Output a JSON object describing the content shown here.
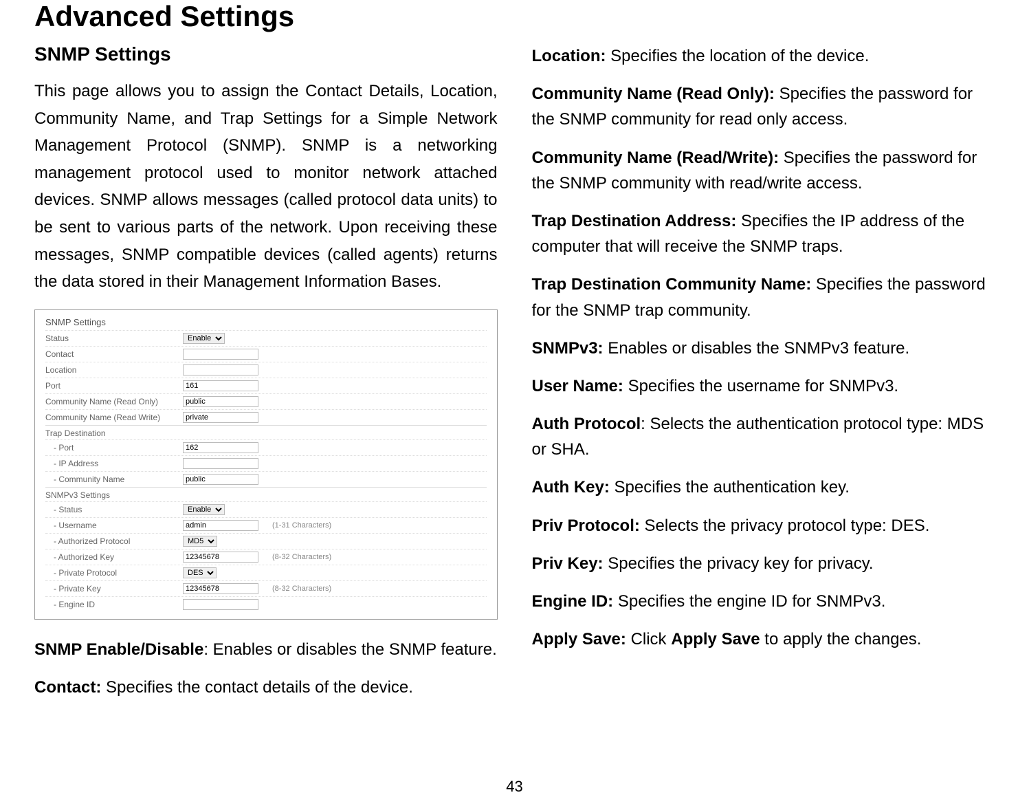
{
  "title": "Advanced Settings",
  "left": {
    "subtitle": "SNMP Settings",
    "intro": "This page allows you to assign the Contact Details, Location, Community Name, and Trap Settings for a Simple Network Management Protocol (SNMP). SNMP is a networking management protocol used to monitor network attached devices. SNMP allows messages (called protocol data units) to be sent to various parts of the network. Upon receiving these messages, SNMP compatible devices (called agents) returns the data stored in their Management Information Bases."
  },
  "screenshot": {
    "header": "SNMP Settings",
    "rows": {
      "status_label": "Status",
      "status_value": "Enable",
      "contact_label": "Contact",
      "contact_value": "",
      "location_label": "Location",
      "location_value": "",
      "port_label": "Port",
      "port_value": "161",
      "comm_ro_label": "Community Name (Read Only)",
      "comm_ro_value": "public",
      "comm_rw_label": "Community Name (Read Write)",
      "comm_rw_value": "private",
      "trap_header": "Trap Destination",
      "trap_port_label": "- Port",
      "trap_port_value": "162",
      "trap_ip_label": "- IP Address",
      "trap_ip_value": "",
      "trap_comm_label": "- Community Name",
      "trap_comm_value": "public",
      "v3_header": "SNMPv3 Settings",
      "v3_status_label": "- Status",
      "v3_status_value": "Enable",
      "v3_user_label": "- Username",
      "v3_user_value": "admin",
      "v3_user_hint": "(1-31 Characters)",
      "v3_authproto_label": "- Authorized Protocol",
      "v3_authproto_value": "MD5",
      "v3_authkey_label": "- Authorized Key",
      "v3_authkey_value": "12345678",
      "v3_authkey_hint": "(8-32 Characters)",
      "v3_privproto_label": "- Private Protocol",
      "v3_privproto_value": "DES",
      "v3_privkey_label": "- Private Key",
      "v3_privkey_value": "12345678",
      "v3_privkey_hint": "(8-32 Characters)",
      "v3_engine_label": "- Engine ID",
      "v3_engine_value": ""
    }
  },
  "defs_left": [
    {
      "term": "SNMP Enable/Disable",
      "sep": ": ",
      "text": "Enables or disables the SNMP feature."
    },
    {
      "term": "Contact:",
      "sep": " ",
      "text": "Specifies the contact details of the device."
    }
  ],
  "defs_right": [
    {
      "term": "Location:",
      "sep": " ",
      "text": "Specifies the location of the device."
    },
    {
      "term": "Community Name (Read Only):",
      "sep": " ",
      "text": "Specifies the password for the SNMP community for read only access."
    },
    {
      "term": "Community Name (Read/Write):",
      "sep": " ",
      "text": "Specifies the password for the SNMP community with read/write access."
    },
    {
      "term": "Trap Destination Address:",
      "sep": " ",
      "text": "Specifies the IP address of the computer that will receive the SNMP traps."
    },
    {
      "term": "Trap Destination Community Name:",
      "sep": " ",
      "text": "Specifies the password for the SNMP trap community."
    },
    {
      "term": "SNMPv3:",
      "sep": " ",
      "text": "Enables or disables the SNMPv3 feature."
    },
    {
      "term": "User Name:",
      "sep": " ",
      "text": "Specifies the username for SNMPv3."
    },
    {
      "term": "Auth Protocol",
      "sep": ": ",
      "text": "Selects the authentication protocol type: MDS or SHA."
    },
    {
      "term": "Auth Key:",
      "sep": " ",
      "text": "Specifies the authentication key."
    },
    {
      "term": "Priv Protocol:",
      "sep": " ",
      "text": "Selects the privacy protocol type: DES."
    },
    {
      "term": "Priv Key:",
      "sep": " ",
      "text": "Specifies the privacy key for privacy."
    },
    {
      "term": "Engine ID:",
      "sep": " ",
      "text": "Specifies the engine ID for SNMPv3."
    },
    {
      "term": "Apply Save:",
      "sep": " ",
      "text_pre": "Click ",
      "bold2": "Apply Save",
      "text_post": " to apply the changes."
    }
  ],
  "page_number": "43"
}
